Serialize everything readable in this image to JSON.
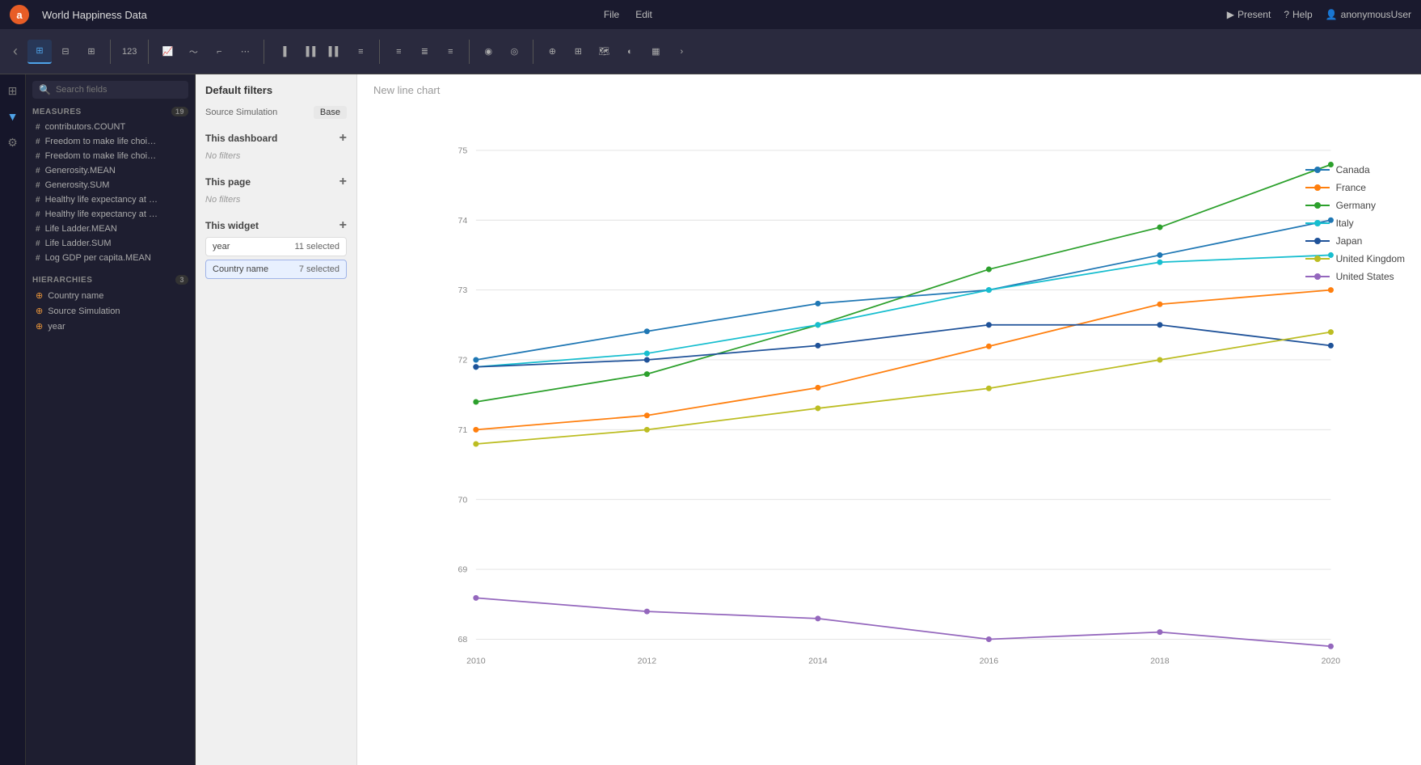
{
  "app": {
    "logo": "a",
    "title": "World Happiness Data",
    "menu": [
      "File",
      "Edit"
    ],
    "toolbar_right": {
      "present": "Present",
      "help": "Help",
      "user": "anonymousUser"
    }
  },
  "sidebar": {
    "search_placeholder": "Search fields",
    "measures_label": "MEASURES",
    "measures_count": "19",
    "hierarchies_label": "HIERARCHIES",
    "hierarchies_count": "3",
    "measures": [
      {
        "prefix": "#",
        "name": "contributors.COUNT"
      },
      {
        "prefix": "#",
        "name": "Freedom to make life choices.ME..."
      },
      {
        "prefix": "#",
        "name": "Freedom to make life choices.SU..."
      },
      {
        "prefix": "#",
        "name": "Generosity.MEAN"
      },
      {
        "prefix": "#",
        "name": "Generosity.SUM"
      },
      {
        "prefix": "#",
        "name": "Healthy life expectancy at birth.M..."
      },
      {
        "prefix": "#",
        "name": "Healthy life expectancy at birth.SU..."
      },
      {
        "prefix": "#",
        "name": "Life Ladder.MEAN"
      },
      {
        "prefix": "#",
        "name": "Life Ladder.SUM"
      },
      {
        "prefix": "#",
        "name": "Log GDP per capita.MEAN"
      }
    ],
    "hierarchies": [
      {
        "name": "Country name"
      },
      {
        "name": "Source Simulation"
      },
      {
        "name": "year"
      }
    ]
  },
  "filters": {
    "title": "Default filters",
    "source_label": "Source Simulation",
    "source_value": "Base",
    "this_dashboard_label": "This dashboard",
    "this_dashboard_empty": "No filters",
    "this_page_label": "This page",
    "this_page_empty": "No filters",
    "this_widget_label": "This widget",
    "filters": [
      {
        "field": "year",
        "value": "11 selected"
      },
      {
        "field": "Country name",
        "value": "7 selected"
      }
    ]
  },
  "chart": {
    "title": "New line chart",
    "y_labels": [
      "75",
      "74",
      "73",
      "72",
      "71",
      "70",
      "69",
      "68"
    ],
    "x_labels": [
      "2010",
      "2012",
      "2014",
      "2016",
      "2018",
      "2020"
    ],
    "legend": [
      {
        "name": "Canada",
        "color": "#1f77b4"
      },
      {
        "name": "France",
        "color": "#ff7f0e"
      },
      {
        "name": "Germany",
        "color": "#2ca02c"
      },
      {
        "name": "Italy",
        "color": "#17becf"
      },
      {
        "name": "Japan",
        "color": "#1f5299"
      },
      {
        "name": "United Kingdom",
        "color": "#bcbd22"
      },
      {
        "name": "United States",
        "color": "#9467bd"
      }
    ]
  }
}
